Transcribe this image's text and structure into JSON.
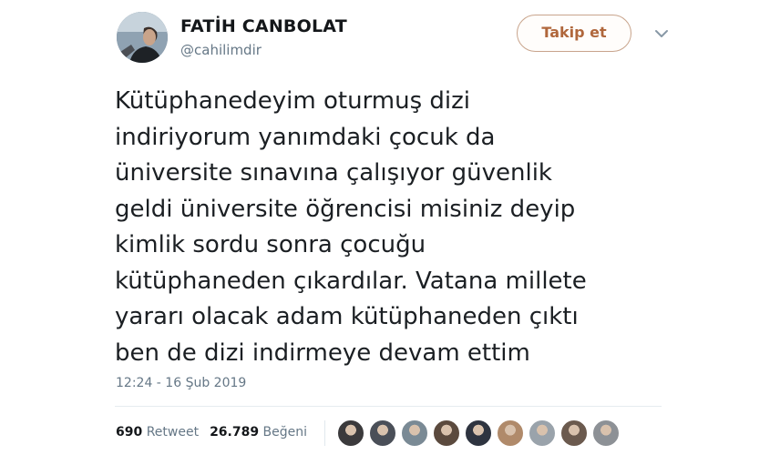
{
  "user": {
    "display_name": "FATİH CANBOLAT",
    "handle": "@cahilimdir",
    "avatar_icon": "profile-photo"
  },
  "actions": {
    "follow_label": "Takip et",
    "menu_icon": "chevron-down-icon"
  },
  "tweet": {
    "lines": [
      "Kütüphanedeyim oturmuş dizi",
      "indiriyorum yanımdaki çocuk da",
      "üniversite sınavına çalışıyor güvenlik",
      "geldi üniversite öğrencisi misiniz deyip",
      "kimlik sordu sonra çocuğu",
      "kütüphaneden çıkardılar. Vatana millete",
      "yararı olacak adam kütüphaneden çıktı",
      "ben de dizi indirmeye devam ettim"
    ],
    "timestamp": "12:24 - 16 Şub 2019"
  },
  "stats": {
    "retweet_count": "690",
    "retweet_label": "Retweet",
    "like_count": "26.789",
    "like_label": "Beğeni"
  },
  "likers": {
    "count": 9,
    "colors": [
      "#3b3a3c",
      "#4a4f58",
      "#7a8a95",
      "#5b4a3e",
      "#2e3440",
      "#b08a6a",
      "#9aa3ab",
      "#6b5a4e",
      "#8d9196"
    ]
  },
  "colors": {
    "follow_accent": "#b0673c",
    "follow_border": "#c8a48c",
    "muted_text": "#657786",
    "main_text": "#1b1f23"
  }
}
